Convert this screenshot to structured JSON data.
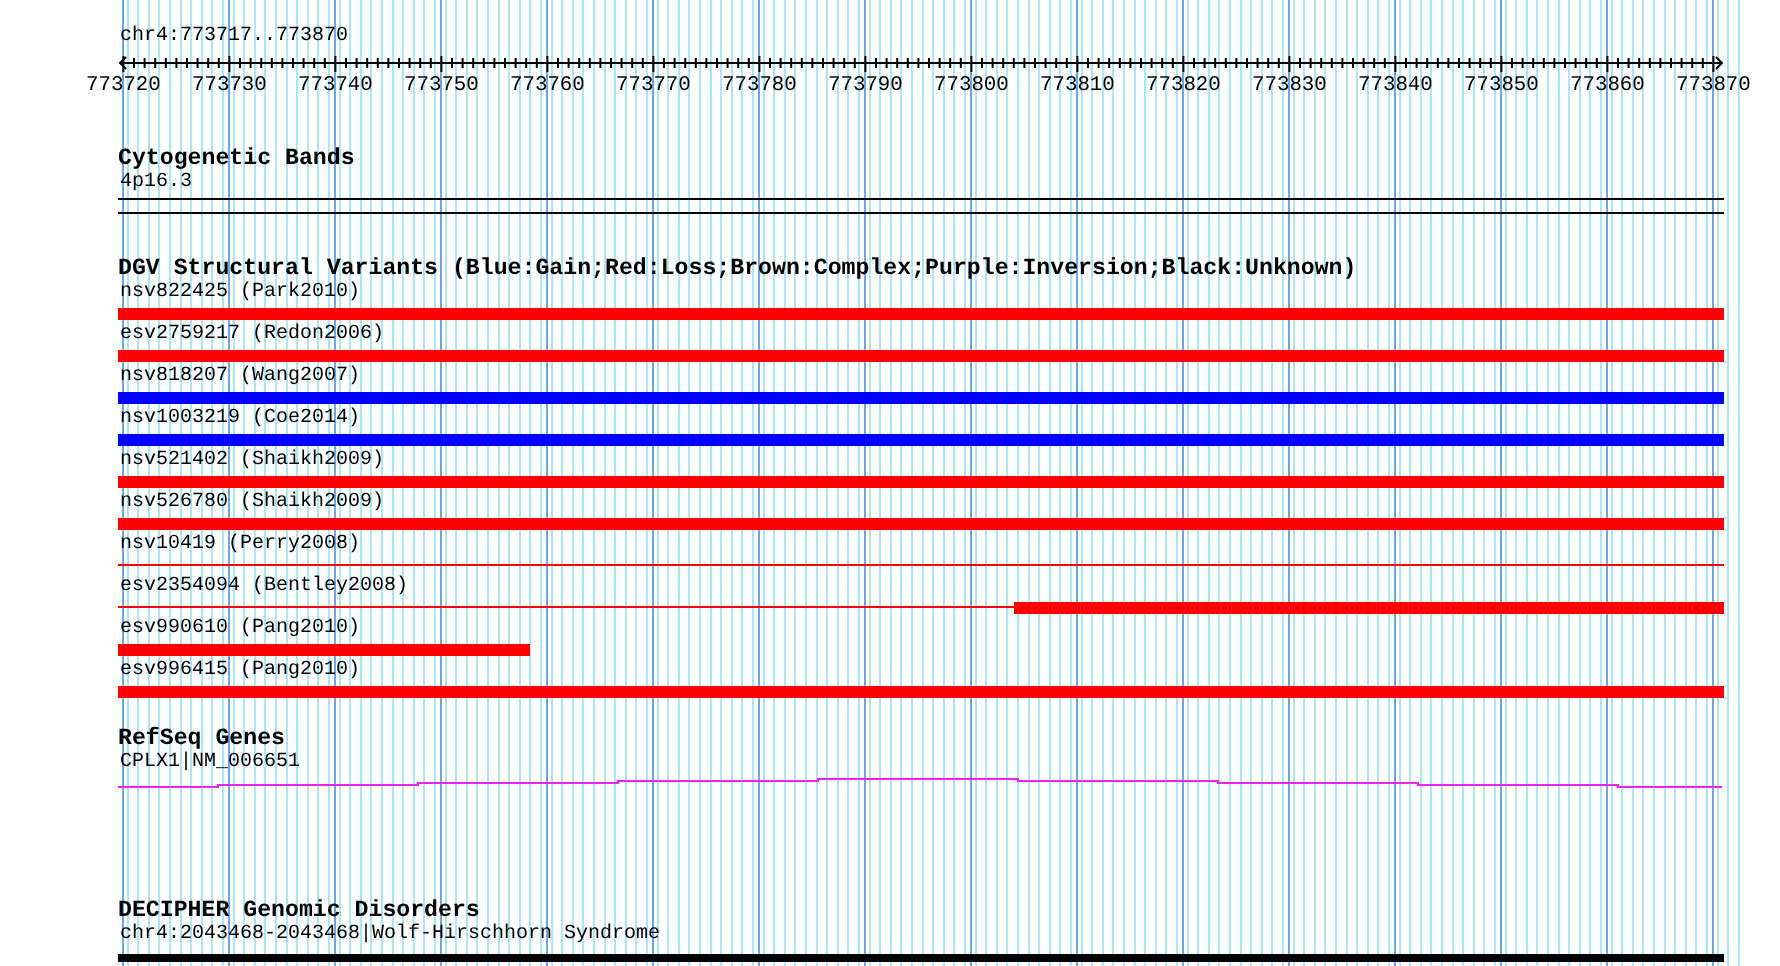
{
  "ruler": {
    "range": "chr4:773717..773870",
    "labels": [
      "773720",
      "773730",
      "773740",
      "773750",
      "773760",
      "773770",
      "773780",
      "773790",
      "773800",
      "773810",
      "773820",
      "773830",
      "773840",
      "773850",
      "773860",
      "773870"
    ]
  },
  "tracks": [
    {
      "kind": "bands",
      "title": "Cytogenetic Bands",
      "items": [
        {
          "label": "4p16.3"
        }
      ]
    },
    {
      "kind": "variants",
      "title": "DGV Structural Variants (Blue:Gain;Red:Loss;Brown:Complex;Purple:Inversion;Black:Unknown)",
      "items": [
        {
          "label": "nsv822425 (Park2010)",
          "color": "#ff0000",
          "kind": "full"
        },
        {
          "label": "esv2759217 (Redon2006)",
          "color": "#ff0000",
          "kind": "full"
        },
        {
          "label": "nsv818207 (Wang2007)",
          "color": "#0000ff",
          "kind": "full"
        },
        {
          "label": "nsv1003219 (Coe2014)",
          "color": "#0000ff",
          "kind": "full"
        },
        {
          "label": "nsv521402 (Shaikh2009)",
          "color": "#ff0000",
          "kind": "full"
        },
        {
          "label": "nsv526780 (Shaikh2009)",
          "color": "#ff0000",
          "kind": "full"
        },
        {
          "label": "nsv10419 (Perry2008)",
          "color": "#ff0000",
          "kind": "line"
        },
        {
          "label": "esv2354094 (Bentley2008)",
          "color": "#ff0000",
          "kind": "right"
        },
        {
          "label": "esv990610 (Pang2010)",
          "color": "#ff0000",
          "kind": "left"
        },
        {
          "label": "esv996415 (Pang2010)",
          "color": "#ff0000",
          "kind": "full"
        }
      ]
    },
    {
      "kind": "genes",
      "title": "RefSeq Genes",
      "items": [
        {
          "label": "CPLX1|NM_006651"
        }
      ]
    },
    {
      "kind": "disorders",
      "title": "DECIPHER Genomic Disorders",
      "items": [
        {
          "label": "chr4:2043468-2043468|Wolf-Hirschhorn Syndrome"
        }
      ]
    }
  ]
}
